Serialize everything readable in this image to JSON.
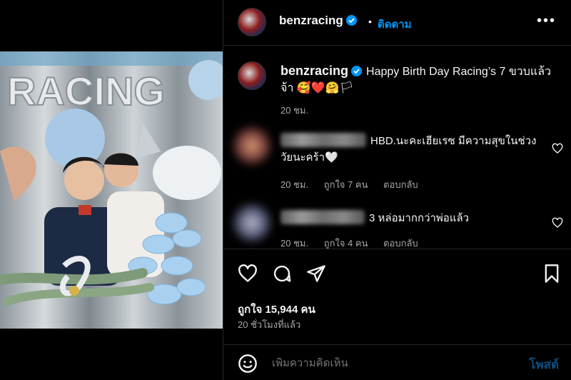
{
  "header": {
    "username": "benzracing",
    "separator": "•",
    "follow_label": "ติดตาม",
    "more_label": "•••"
  },
  "caption": {
    "username": "benzracing",
    "text": "Happy Birth Day Racing’s 7 ขวบแล้วจ้า 🥰❤️🤗🏳",
    "time": "20 ชม."
  },
  "comments": [
    {
      "text": "HBD.นะคะเฮียเรซ มีความสุขในช่วงวัยนะคร้า🤍",
      "time": "20 ชม.",
      "likes": "ถูกใจ 7 คน",
      "reply": "ตอบกลับ"
    },
    {
      "text": "3 หล่อมากกว่าพ่อแล้ว",
      "time": "20 ชม.",
      "likes": "ถูกใจ 4 คน",
      "reply": "ตอบกลับ"
    }
  ],
  "post": {
    "likes": "ถูกใจ 15,944 คน",
    "posted_ago": "20 ชั่วโมงที่แล้ว"
  },
  "add_comment": {
    "placeholder": "เพิ่มความคิดเห็น",
    "post_label": "โพสต์"
  },
  "icons": {
    "verified": "verified-badge-icon",
    "like": "heart-icon",
    "comment": "comment-icon",
    "share": "share-icon",
    "save": "bookmark-icon",
    "emoji": "emoji-icon"
  },
  "colors": {
    "accent": "#0095f6",
    "background": "#000000",
    "text": "#f5f5f5",
    "muted": "#a8a8a8"
  }
}
